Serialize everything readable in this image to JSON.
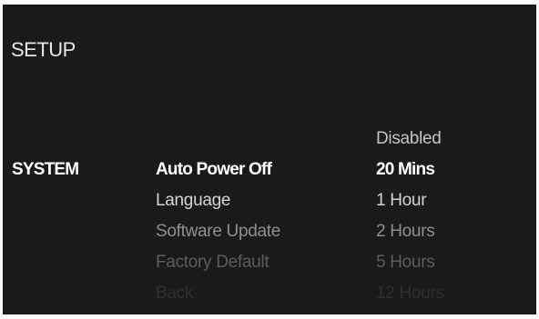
{
  "header": {
    "title": "SETUP"
  },
  "section": {
    "label": "SYSTEM"
  },
  "menu": {
    "items": [
      {
        "label": "Auto Power Off"
      },
      {
        "label": "Language"
      },
      {
        "label": "Software Update"
      },
      {
        "label": "Factory Default"
      },
      {
        "label": "Back"
      }
    ],
    "selected": "Auto Power Off"
  },
  "options": {
    "items": [
      {
        "label": "Disabled"
      },
      {
        "label": "20 Mins"
      },
      {
        "label": "1 Hour"
      },
      {
        "label": "2 Hours"
      },
      {
        "label": "5 Hours"
      },
      {
        "label": "12 Hours"
      }
    ],
    "selected": "20 Mins"
  },
  "colors": {
    "background": "#1a1a1a",
    "selected_text": "#ffffff"
  }
}
